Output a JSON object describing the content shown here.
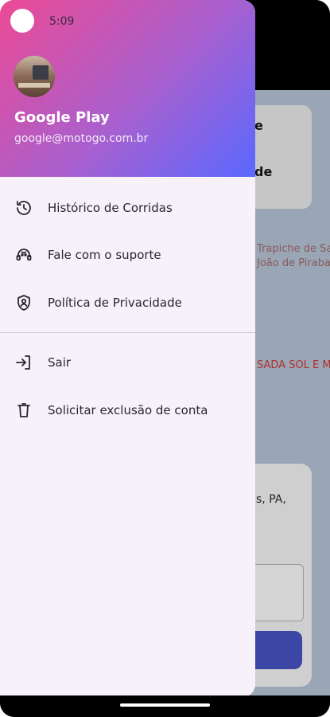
{
  "status_bar": {
    "time": "5:09"
  },
  "drawer": {
    "user": {
      "name": "Google Play",
      "email": "google@motogo.com.br"
    },
    "items": [
      {
        "label": "Histórico de Corridas",
        "icon": "history-icon"
      },
      {
        "label": "Fale com o suporte",
        "icon": "support-agent-icon"
      },
      {
        "label": "Política de Privacidade",
        "icon": "shield-icon"
      },
      {
        "label": "Sair",
        "icon": "logout-icon"
      },
      {
        "label": "Solicitar exclusão de conta",
        "icon": "trash-icon"
      }
    ]
  },
  "background": {
    "card_text_1": "e",
    "card_text_2": "de",
    "map_label_1": "Trapiche de Sa",
    "map_label_2": "João de Piraba",
    "map_label_3": "SADA SOL E M",
    "address": "s, PA,"
  },
  "colors": {
    "header_gradient_start": "#ec4a94",
    "header_gradient_end": "#5a68ff",
    "drawer_bg": "#f7f2fa"
  }
}
